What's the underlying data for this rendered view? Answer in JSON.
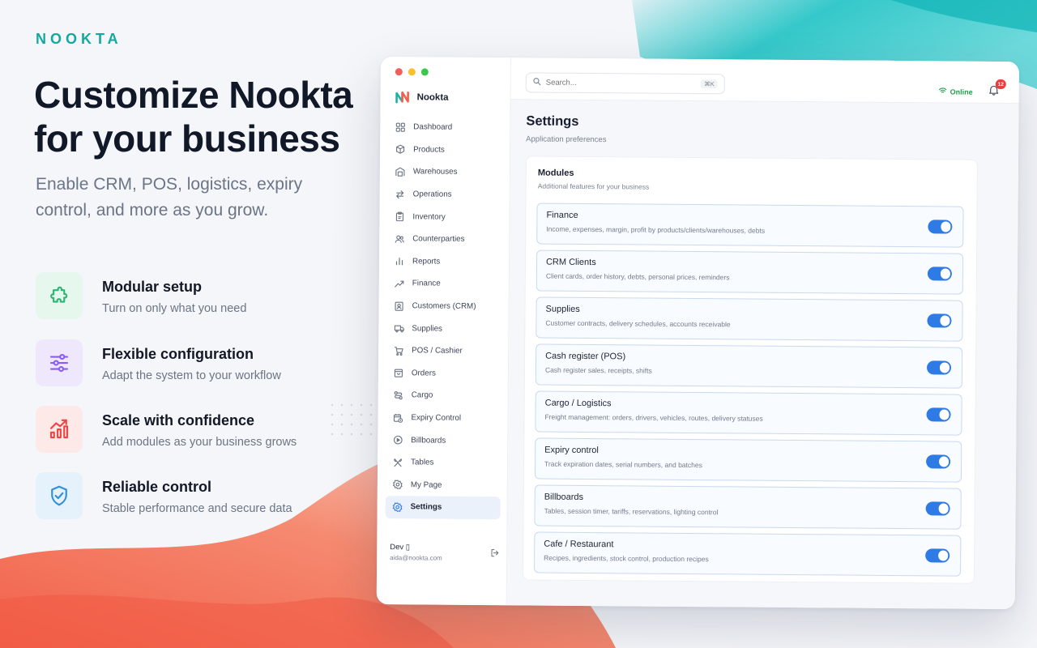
{
  "brand": "NOOKTA",
  "headline": "Customize Nookta for your business",
  "subhead": "Enable CRM, POS, logistics, expiry control, and more as you grow.",
  "features": [
    {
      "title": "Modular setup",
      "subtitle": "Turn on only what you need",
      "icon": "puzzle-icon",
      "color": "#2bb673",
      "bg": "#e6f7ee"
    },
    {
      "title": "Flexible configuration",
      "subtitle": "Adapt the system to your workflow",
      "icon": "sliders-icon",
      "color": "#8a5cf6",
      "bg": "#efe8fd"
    },
    {
      "title": "Scale with confidence",
      "subtitle": "Add modules as your business grows",
      "icon": "chart-growth-icon",
      "color": "#ef4444",
      "bg": "#fde9e7"
    },
    {
      "title": "Reliable control",
      "subtitle": "Stable performance and secure data",
      "icon": "shield-check-icon",
      "color": "#2f8fdb",
      "bg": "#e5f2fb"
    }
  ],
  "app": {
    "name": "Nookta",
    "search_placeholder": "Search...",
    "search_shortcut": "⌘K",
    "status": "Online",
    "notifications": "12",
    "nav": [
      {
        "label": "Dashboard",
        "icon": "grid-icon"
      },
      {
        "label": "Products",
        "icon": "box-icon"
      },
      {
        "label": "Warehouses",
        "icon": "warehouse-icon"
      },
      {
        "label": "Operations",
        "icon": "arrows-swap-icon"
      },
      {
        "label": "Inventory",
        "icon": "clipboard-icon"
      },
      {
        "label": "Counterparties",
        "icon": "users-icon"
      },
      {
        "label": "Reports",
        "icon": "bar-chart-icon"
      },
      {
        "label": "Finance",
        "icon": "trend-icon"
      },
      {
        "label": "Customers (CRM)",
        "icon": "contact-icon"
      },
      {
        "label": "Supplies",
        "icon": "truck-icon"
      },
      {
        "label": "POS / Cashier",
        "icon": "cart-icon"
      },
      {
        "label": "Orders",
        "icon": "bag-icon"
      },
      {
        "label": "Cargo",
        "icon": "route-icon"
      },
      {
        "label": "Expiry Control",
        "icon": "calendar-clock-icon"
      },
      {
        "label": "Billboards",
        "icon": "play-circle-icon"
      },
      {
        "label": "Tables",
        "icon": "utensils-icon"
      },
      {
        "label": "My Page",
        "icon": "gear-user-icon"
      },
      {
        "label": "Settings",
        "icon": "gear-icon",
        "active": true
      }
    ],
    "user": {
      "name": "Dev ▯",
      "email": "aida@nookta.com"
    },
    "page_title": "Settings",
    "page_subtitle": "Application preferences",
    "modules_title": "Modules",
    "modules_subtitle": "Additional features for your business",
    "modules": [
      {
        "title": "Finance",
        "desc": "Income, expenses, margin, profit by products/clients/warehouses, debts",
        "enabled": true
      },
      {
        "title": "CRM Clients",
        "desc": "Client cards, order history, debts, personal prices, reminders",
        "enabled": true
      },
      {
        "title": "Supplies",
        "desc": "Customer contracts, delivery schedules, accounts receivable",
        "enabled": true
      },
      {
        "title": "Cash register (POS)",
        "desc": "Cash register sales, receipts, shifts",
        "enabled": true
      },
      {
        "title": "Cargo / Logistics",
        "desc": "Freight management: orders, drivers, vehicles, routes, delivery statuses",
        "enabled": true
      },
      {
        "title": "Expiry control",
        "desc": "Track expiration dates, serial numbers, and batches",
        "enabled": true
      },
      {
        "title": "Billboards",
        "desc": "Tables, session timer, tariffs, reservations, lighting control",
        "enabled": true
      },
      {
        "title": "Cafe / Restaurant",
        "desc": "Recipes, ingredients, stock control, production recipes",
        "enabled": true
      }
    ]
  },
  "colors": {
    "accent": "#2f7be6",
    "brand_teal": "#14a8a0",
    "online": "#22a04a",
    "badge": "#ef3b3b"
  }
}
